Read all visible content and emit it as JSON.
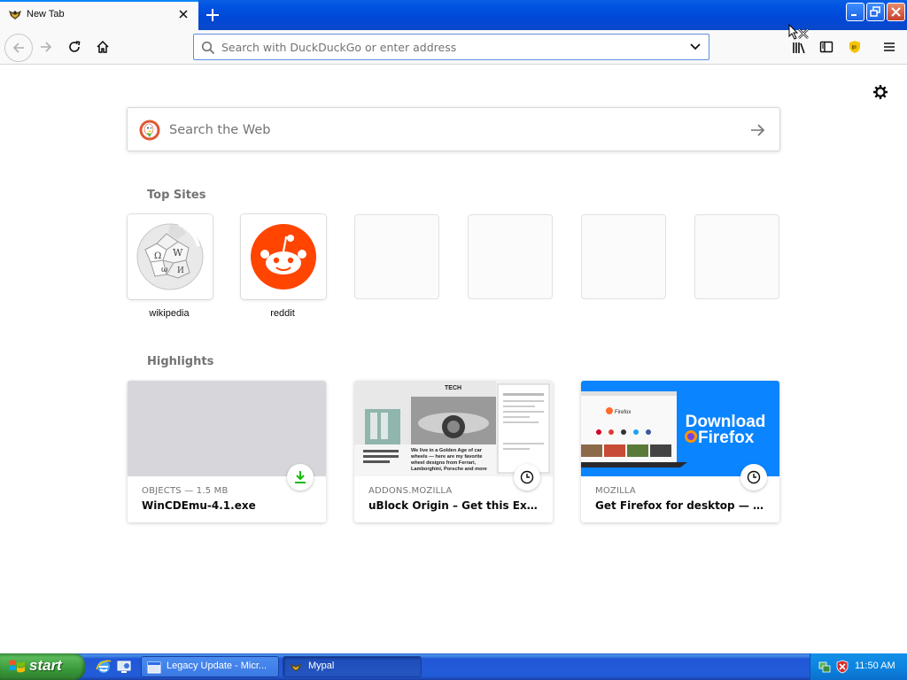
{
  "tab": {
    "title": "New Tab"
  },
  "urlbar": {
    "placeholder": "Search with DuckDuckGo or enter address"
  },
  "search": {
    "placeholder": "Search the Web"
  },
  "sections": {
    "top_sites": "Top Sites",
    "highlights": "Highlights"
  },
  "top_sites": [
    {
      "label": "wikipedia",
      "icon": "wikipedia-icon"
    },
    {
      "label": "reddit",
      "icon": "reddit-icon"
    },
    {
      "label": ""
    },
    {
      "label": ""
    },
    {
      "label": ""
    },
    {
      "label": ""
    }
  ],
  "highlights": [
    {
      "context": "OBJECTS — 1.5 MB",
      "title": "WinCDEmu-4.1.exe",
      "badge": "download-icon"
    },
    {
      "context": "ADDONS.MOZILLA",
      "title": "uBlock Origin – Get this Extension for Firefox",
      "badge": "clock-icon",
      "thumb_text": {
        "header": "TECH",
        "caption": "We live in a Golden Age of car wheels — here are my favorite wheel designs from Ferrari, Lamborghini, Porsche and more"
      }
    },
    {
      "context": "MOZILLA",
      "title": "Get Firefox for desktop — Mozilla",
      "badge": "clock-icon",
      "thumb_text": {
        "line1": "Download",
        "line2": "Firefox",
        "mini": "Firefox"
      }
    }
  ],
  "taskbar": {
    "start_label": "start",
    "tasks": [
      {
        "label": "Legacy Update - Micr...",
        "active": false
      },
      {
        "label": "Mypal",
        "active": true
      }
    ],
    "clock": "11:50 AM"
  },
  "colors": {
    "accent": "#0a84ff",
    "reddit": "#ff4500",
    "ddg": "#de5833",
    "mozilla_blue": "#0a84ff",
    "xp_blue": "#245edb",
    "start_green": "#3c9a3c"
  }
}
